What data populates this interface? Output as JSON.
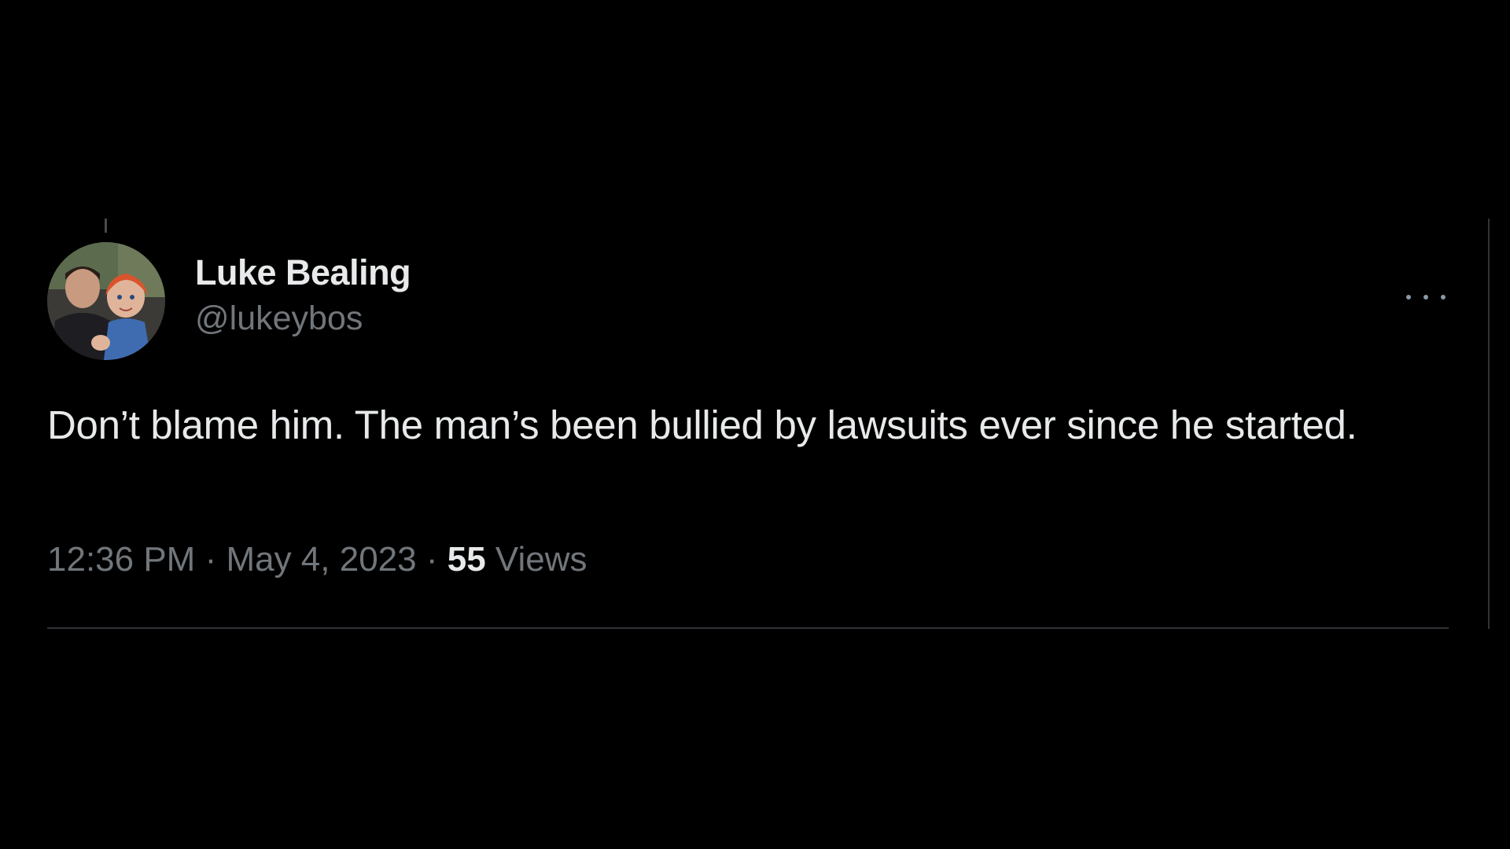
{
  "tweet": {
    "author": {
      "display_name": "Luke Bealing",
      "handle": "@lukeybos",
      "avatar_icon": "profile-photo"
    },
    "menu_icon": "more-options-icon",
    "text": "Don’t blame him. The man’s been bullied by lawsuits ever since he started.",
    "time": "12:36 PM",
    "separator": " · ",
    "date": "May 4, 2023",
    "views_count": "55",
    "views_label": " Views"
  },
  "colors": {
    "background": "#000000",
    "primary_text": "#e7e9ea",
    "secondary_text": "#71767b",
    "divider": "#2f3336"
  }
}
